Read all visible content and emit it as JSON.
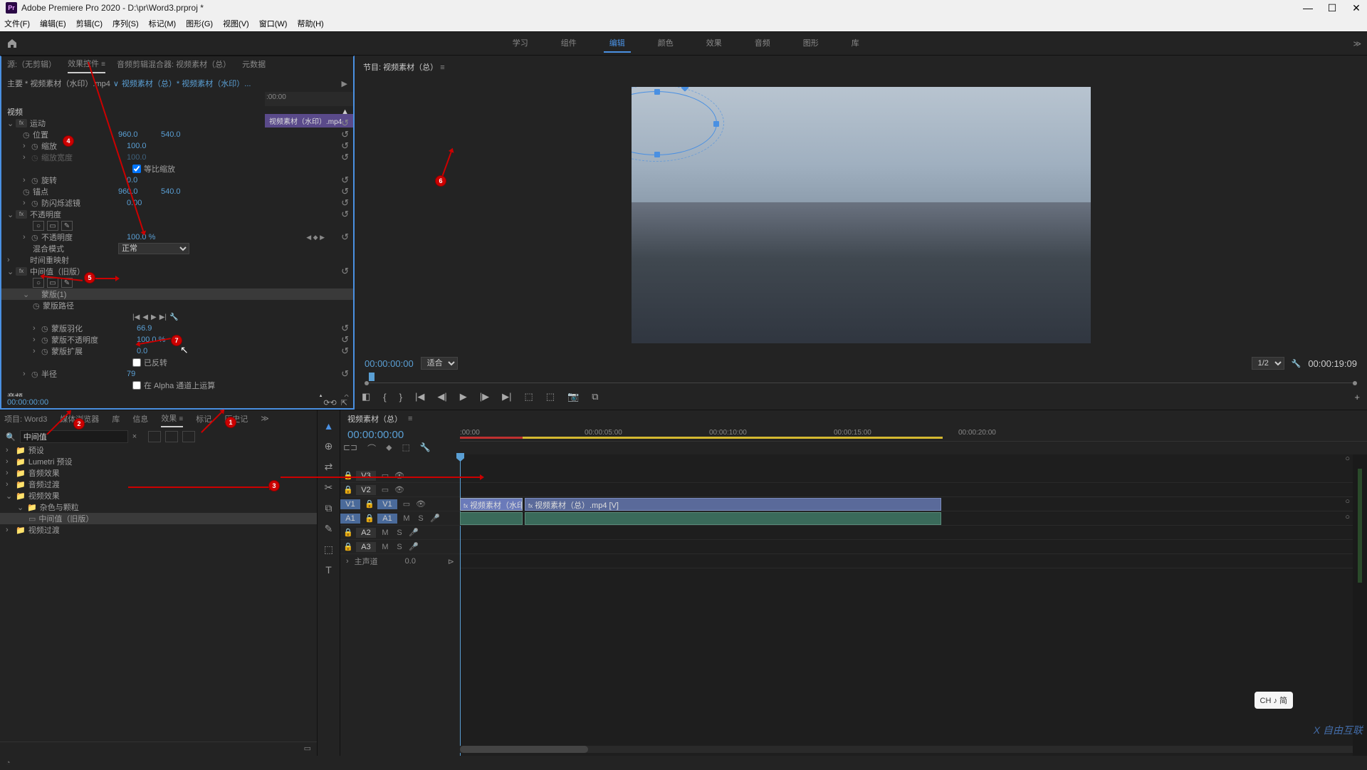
{
  "titlebar": {
    "app_logo": "Pr",
    "title": "Adobe Premiere Pro 2020 - D:\\pr\\Word3.prproj *"
  },
  "menu": [
    "文件(F)",
    "编辑(E)",
    "剪辑(C)",
    "序列(S)",
    "标记(M)",
    "图形(G)",
    "视图(V)",
    "窗口(W)",
    "帮助(H)"
  ],
  "workspace": {
    "tabs": [
      "学习",
      "组件",
      "编辑",
      "颜色",
      "效果",
      "音频",
      "图形",
      "库"
    ],
    "active": "编辑",
    "more": "≫"
  },
  "source_panel": {
    "tabs": [
      "源:（无剪辑）",
      "效果控件",
      "音频剪辑混合器: 视频素材（总）",
      "元数据"
    ],
    "active": "效果控件",
    "breadcrumb": {
      "master": "主要 * 视频素材（水印）.mp4",
      "sep": "∨",
      "seq": "视频素材（总）* 视频素材（水印）..."
    },
    "timeline_start": ":00:00",
    "clip_name": "视频素材（水印）.mp4",
    "sections": {
      "video": "视频",
      "motion": "运动",
      "position": "位置",
      "position_x": "960.0",
      "position_y": "540.0",
      "scale": "缩放",
      "scale_val": "100.0",
      "scale_w": "缩放宽度",
      "scale_w_val": "100.0",
      "uniform": "等比缩放",
      "rotation": "旋转",
      "rotation_val": "0.0",
      "anchor": "锚点",
      "anchor_x": "960.0",
      "anchor_y": "540.0",
      "antiflicker": "防闪烁滤镜",
      "antiflicker_val": "0.00",
      "opacity": "不透明度",
      "opacity_label": "不透明度",
      "opacity_val": "100.0 %",
      "blend": "混合模式",
      "blend_val": "正常",
      "timeremap": "时间重映射",
      "median": "中间值（旧版）",
      "mask1": "蒙版(1)",
      "maskpath": "蒙版路径",
      "maskfeather": "蒙版羽化",
      "maskfeather_val": "66.9",
      "maskopacity": "蒙版不透明度",
      "maskopacity_val": "100.0 %",
      "maskexpand": "蒙版扩展",
      "maskexpand_val": "0.0",
      "inverted": "已反转",
      "radius": "半径",
      "radius_val": "79",
      "alpha": "在 Alpha 通道上运算",
      "audio": "音频"
    },
    "footer_tc": "00:00:00:00"
  },
  "program": {
    "title": "节目: 视频素材（总）",
    "tc_left": "00:00:00:00",
    "fit": "适合",
    "zoom": "1/2",
    "tc_right": "00:00:19:09"
  },
  "project": {
    "tabs": [
      "项目: Word3",
      "媒体浏览器",
      "库",
      "信息",
      "效果",
      "标记",
      "历史记"
    ],
    "active": "效果",
    "more": "≫",
    "search_value": "中间值",
    "tree": [
      {
        "label": "预设",
        "type": "folder"
      },
      {
        "label": "Lumetri 预设",
        "type": "folder"
      },
      {
        "label": "音频效果",
        "type": "folder"
      },
      {
        "label": "音频过渡",
        "type": "folder"
      },
      {
        "label": "视频效果",
        "type": "folder",
        "expanded": true
      },
      {
        "label": "杂色与颗粒",
        "type": "folder",
        "expanded": true,
        "indent": 1
      },
      {
        "label": "中间值（旧版）",
        "type": "effect",
        "indent": 2,
        "selected": true
      },
      {
        "label": "视频过渡",
        "type": "folder"
      }
    ]
  },
  "tools": [
    "▲",
    "⊕",
    "⇄",
    "✂",
    "⧉",
    "✎",
    "⬚",
    "T"
  ],
  "timeline": {
    "seq_name": "视频素材（总）",
    "tc": "00:00:00:00",
    "ruler_ticks": [
      {
        "label": ":00:00",
        "pos": 0
      },
      {
        "label": "00:00:05:00",
        "pos": 175
      },
      {
        "label": "00:00:10:00",
        "pos": 350
      },
      {
        "label": "00:00:15:00",
        "pos": 525
      },
      {
        "label": "00:00:20:00",
        "pos": 700
      }
    ],
    "tracks": {
      "v3": "V3",
      "v2": "V2",
      "v1": "V1",
      "a1": "A1",
      "a2": "A2",
      "a3": "A3",
      "master": "主声道",
      "master_val": "0.0"
    },
    "clips": {
      "v1_top": "视频素材（水印",
      "v1_main": "视频素材（总）.mp4 [V]"
    }
  },
  "annotations": {
    "1": "1",
    "2": "2",
    "3": "3",
    "4": "4",
    "5": "5",
    "6": "6",
    "7": "7"
  },
  "ime": "CH ♪ 简",
  "watermark": "X 自由互联"
}
